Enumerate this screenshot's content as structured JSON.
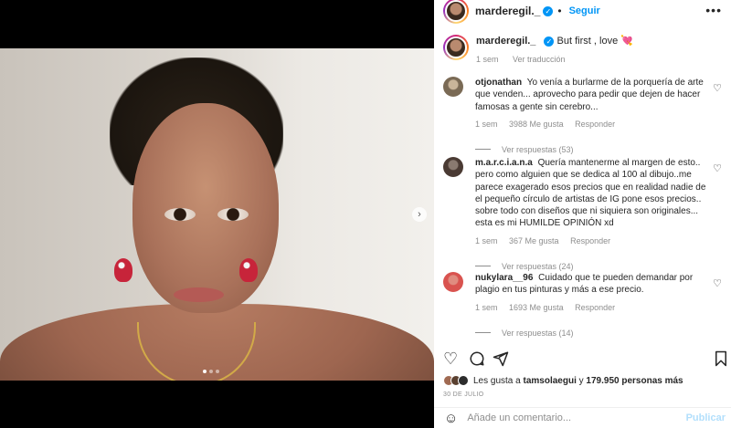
{
  "header": {
    "username": "marderegil._",
    "follow_label": "Seguir",
    "more_label": "•••"
  },
  "caption": {
    "username": "marderegil._",
    "text": "But first , love 💘",
    "time": "1 sem",
    "translation_label": "Ver traducción"
  },
  "comments": [
    {
      "user": "otjonathan",
      "text": "Yo venía a burlarme de la porquería de arte que venden... aprovecho para pedir que dejen de hacer famosas a gente sin cerebro...",
      "time": "1 sem",
      "likes": "3988 Me gusta",
      "reply_label": "Responder",
      "replies": "Ver respuestas (53)",
      "avatar_color": "#7a6a55"
    },
    {
      "user": "m.a.r.c.i.a.n.a",
      "text": "Quería mantenerme al margen de esto.. pero como alguien que se dedica al 100 al dibujo..me parece exagerado esos precios que en realidad nadie de el pequeño círculo de artistas de IG pone esos precios.. sobre todo con diseños que ni siquiera son originales... esta es mi HUMILDE OPINIÓN xd",
      "time": "1 sem",
      "likes": "367 Me gusta",
      "reply_label": "Responder",
      "replies": "Ver respuestas (24)",
      "avatar_color": "#4a3a33"
    },
    {
      "user": "nukylara__96",
      "text": "Cuidado que te pueden demandar por plagio en tus pinturas y más a ese precio.",
      "time": "1 sem",
      "likes": "1693 Me gusta",
      "reply_label": "Responder",
      "replies": "Ver respuestas (14)",
      "avatar_color": "#d9534f"
    }
  ],
  "likes": {
    "prefix": "Les gusta a",
    "user": "tamsolaegui",
    "middle": "y",
    "count": "179.950",
    "suffix": "personas más"
  },
  "date": "30 DE JULIO",
  "comment_box": {
    "placeholder": "Añade un comentario...",
    "publish_label": "Publicar"
  },
  "icons": [
    "heart-icon",
    "comment-icon",
    "share-icon",
    "bookmark-icon",
    "emoji-icon",
    "chevron-right-icon",
    "more-icon"
  ],
  "colors": {
    "accent": "#0095f6",
    "publish_disabled": "#b2dffc",
    "muted": "#8e8e8e"
  }
}
